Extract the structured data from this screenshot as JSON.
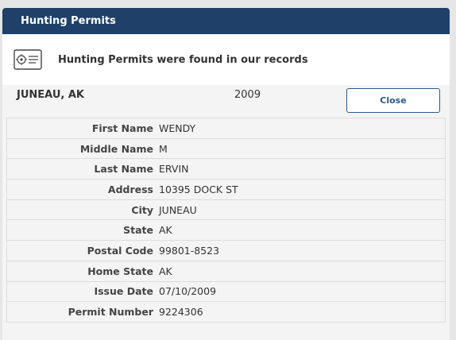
{
  "header": {
    "title": "Hunting Permits"
  },
  "notice": {
    "icon": "permit-card-icon",
    "text": "Hunting Permits were found in our records"
  },
  "summary": {
    "location": "JUNEAU, AK",
    "year": "2009",
    "close_label": "Close"
  },
  "details": [
    {
      "label": "First Name",
      "value": "WENDY"
    },
    {
      "label": "Middle Name",
      "value": "M"
    },
    {
      "label": "Last Name",
      "value": "ERVIN"
    },
    {
      "label": "Address",
      "value": "10395 DOCK ST"
    },
    {
      "label": "City",
      "value": "JUNEAU"
    },
    {
      "label": "State",
      "value": "AK"
    },
    {
      "label": "Postal Code",
      "value": "99801-8523"
    },
    {
      "label": "Home State",
      "value": "AK"
    },
    {
      "label": "Issue Date",
      "value": "07/10/2009"
    },
    {
      "label": "Permit Number",
      "value": "9224306"
    }
  ],
  "colors": {
    "header_bg": "#1f4068",
    "accent": "#2a5a8c"
  }
}
